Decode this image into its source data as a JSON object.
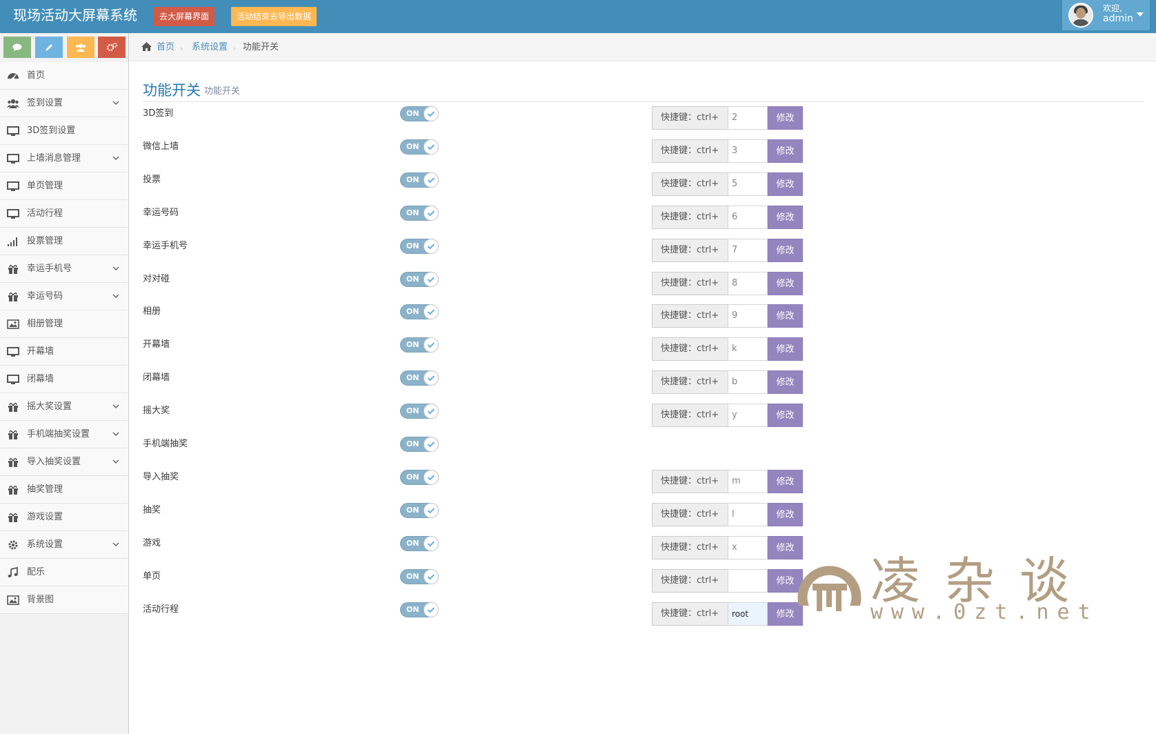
{
  "header": {
    "brand": "现场活动大屏幕系统",
    "btn_screen": "去大屏幕界面",
    "btn_export": "活动结束去导出数据",
    "welcome": "欢迎,",
    "user": "admin",
    "colors": {
      "bar": "#438eb9",
      "red": "#d15b47",
      "orange": "#ffb752"
    }
  },
  "shortcuts": [
    {
      "icon": "comment-icon",
      "color": "#87b87f"
    },
    {
      "icon": "pencil-icon",
      "color": "#6fb3e0"
    },
    {
      "icon": "users-icon",
      "color": "#ffb752"
    },
    {
      "icon": "cogs-icon",
      "color": "#d15b47"
    }
  ],
  "sidebar": {
    "items": [
      {
        "label": "首页",
        "icon": "dashboard-icon",
        "has_sub": false
      },
      {
        "label": "签到设置",
        "icon": "users-icon",
        "has_sub": true
      },
      {
        "label": "3D签到设置",
        "icon": "desktop-icon",
        "has_sub": false
      },
      {
        "label": "上墙消息管理",
        "icon": "desktop-icon",
        "has_sub": true
      },
      {
        "label": "单页管理",
        "icon": "desktop-icon",
        "has_sub": false
      },
      {
        "label": "活动行程",
        "icon": "desktop-icon",
        "has_sub": false
      },
      {
        "label": "投票管理",
        "icon": "signal-icon",
        "has_sub": false
      },
      {
        "label": "幸运手机号",
        "icon": "gift-icon",
        "has_sub": true
      },
      {
        "label": "幸运号码",
        "icon": "gift-icon",
        "has_sub": true
      },
      {
        "label": "相册管理",
        "icon": "picture-icon",
        "has_sub": false
      },
      {
        "label": "开幕墙",
        "icon": "desktop-icon",
        "has_sub": false
      },
      {
        "label": "闭幕墙",
        "icon": "desktop-icon",
        "has_sub": false
      },
      {
        "label": "摇大奖设置",
        "icon": "gift-icon",
        "has_sub": true
      },
      {
        "label": "手机端抽奖设置",
        "icon": "gift-icon",
        "has_sub": true
      },
      {
        "label": "导入抽奖设置",
        "icon": "gift-icon",
        "has_sub": true
      },
      {
        "label": "抽奖管理",
        "icon": "gift-icon",
        "has_sub": false
      },
      {
        "label": "游戏设置",
        "icon": "gift-icon",
        "has_sub": false
      },
      {
        "label": "系统设置",
        "icon": "cog-icon",
        "has_sub": true
      },
      {
        "label": "配乐",
        "icon": "music-icon",
        "has_sub": false
      },
      {
        "label": "背景图",
        "icon": "picture-icon",
        "has_sub": false
      }
    ]
  },
  "breadcrumb": {
    "home": "首页",
    "parent": "系统设置",
    "current": "功能开关",
    "sep": "›"
  },
  "page": {
    "title": "功能开关",
    "subtitle": "功能开关"
  },
  "hotkey_prefix": "快捷键：ctrl+",
  "modify_label": "修改",
  "toggle_text": "ON",
  "rows": [
    {
      "label": "3D签到",
      "key": "2",
      "has_hotkey": true
    },
    {
      "label": "微信上墙",
      "key": "3",
      "has_hotkey": true
    },
    {
      "label": "投票",
      "key": "5",
      "has_hotkey": true
    },
    {
      "label": "幸运号码",
      "key": "6",
      "has_hotkey": true
    },
    {
      "label": "幸运手机号",
      "key": "7",
      "has_hotkey": true
    },
    {
      "label": "对对碰",
      "key": "8",
      "has_hotkey": true
    },
    {
      "label": "相册",
      "key": "9",
      "has_hotkey": true
    },
    {
      "label": "开幕墙",
      "key": "k",
      "has_hotkey": true
    },
    {
      "label": "闭幕墙",
      "key": "b",
      "has_hotkey": true
    },
    {
      "label": "摇大奖",
      "key": "y",
      "has_hotkey": true
    },
    {
      "label": "手机端抽奖",
      "key": "",
      "has_hotkey": false
    },
    {
      "label": "导入抽奖",
      "key": "m",
      "has_hotkey": true
    },
    {
      "label": "抽奖",
      "key": "l",
      "has_hotkey": true
    },
    {
      "label": "游戏",
      "key": "x",
      "has_hotkey": true
    },
    {
      "label": "单页",
      "key": "",
      "has_hotkey": true
    },
    {
      "label": "活动行程",
      "key": "root",
      "has_hotkey": true,
      "focused": true
    }
  ],
  "watermark": {
    "chars": "凌杂谈",
    "url": "www.0zt.net",
    "color": "#b39e82"
  }
}
